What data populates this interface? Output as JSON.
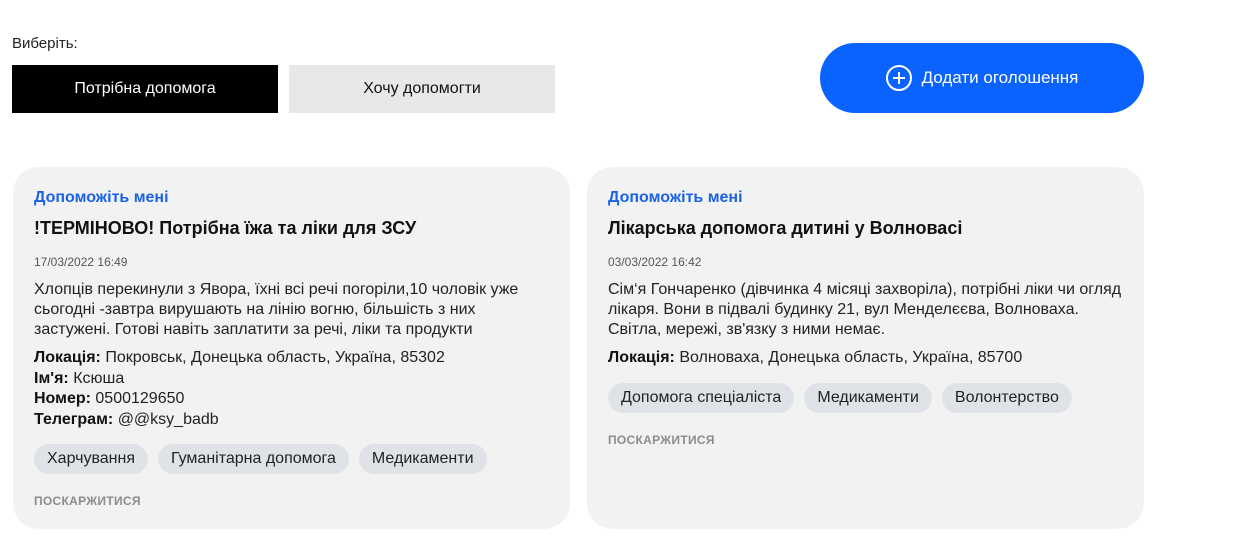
{
  "filter": {
    "label": "Виберіть:",
    "options": [
      "Потрібна допомога",
      "Хочу допомогти"
    ],
    "selected": "Потрібна допомога"
  },
  "add_button": {
    "label": "Додати оголошення",
    "icon": "plus-circle-icon"
  },
  "colors": {
    "accent": "#0a63ff",
    "kicker": "#1a62e8",
    "card_bg": "#f2f2f2",
    "tag_bg": "#dfe3e8"
  },
  "cards": [
    {
      "kicker": "Допоможіть мені",
      "title": "!ТЕРМІНОВО! Потрібна їжа та ліки для ЗСУ",
      "date": "17/03/2022 16:49",
      "description": "Хлопців перекинули з Явора, їхні всі речі погоріли,10 чоловік уже сьогодні -завтра вирушають на лінію вогню, більшість з них застужені. Готові навіть заплатити за речі, ліки та продукти",
      "location_label": "Локація:",
      "location": "Покровськ, Донецька область, Україна, 85302",
      "name_label": "Ім'я:",
      "name": "Ксюша",
      "phone_label": "Номер:",
      "phone": "0500129650",
      "telegram_label": "Телеграм:",
      "telegram": "@@ksy_badb",
      "tags": [
        "Харчування",
        "Гуманітарна допомога",
        "Медикаменти"
      ],
      "complain": "ПОСКАРЖИТИСЯ"
    },
    {
      "kicker": "Допоможіть мені",
      "title": "Лікарська допомога дитині у Волновасі",
      "date": "03/03/2022 16:42",
      "description": "Сім‘я Гончаренко (дівчинка 4 місяці захворіла), потрібні ліки чи огляд лікаря. Вони в підвалі будинку 21, вул Менделєєва, Волноваха. Світла, мережі, зв'язку з ними немає.",
      "location_label": "Локація:",
      "location": "Волноваха, Донецька область, Україна, 85700",
      "tags": [
        "Допомога спеціаліста",
        "Медикаменти",
        "Волонтерство"
      ],
      "complain": "ПОСКАРЖИТИСЯ"
    }
  ]
}
